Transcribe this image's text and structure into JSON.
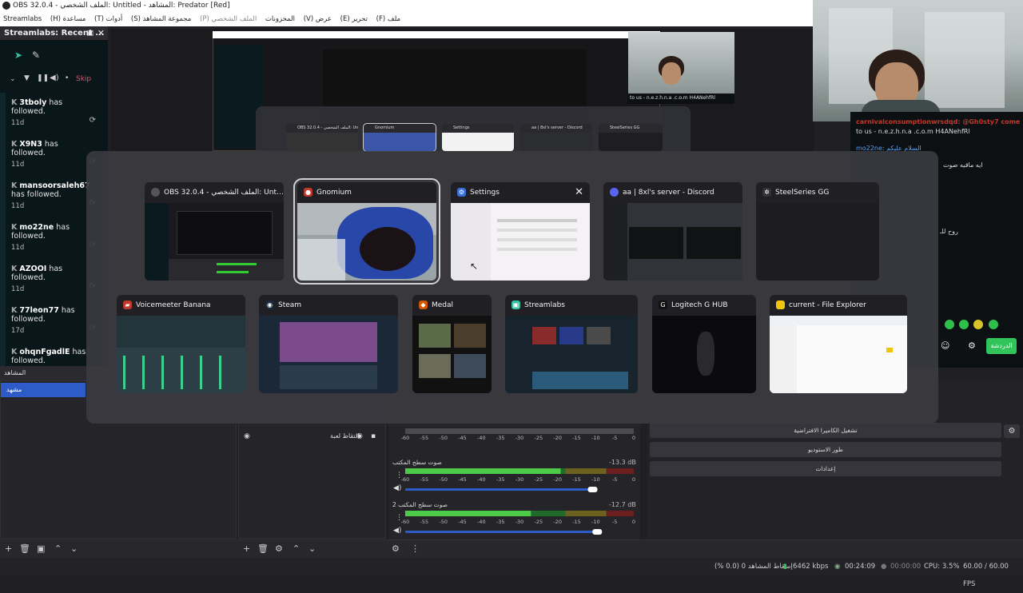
{
  "titlebar": {
    "title": "OBS 32.0.4 - الملف الشخصي: Untitled - المشاهد: Predator [Red]"
  },
  "menu": {
    "items": [
      "ملف (F)",
      "تحرير (E)",
      "عرض (V)",
      "المخزونات",
      "الملف الشخصي (P)",
      "مجموعة المشاهد (S)",
      "أدوات (T)",
      "مساعدة (H)",
      "Streamlabs"
    ]
  },
  "streamlabs": {
    "title": "Streamlabs: Recent ...",
    "skip_label": "Skip",
    "events": [
      {
        "user": "3tboly",
        "text": "has followed.",
        "age": "11d"
      },
      {
        "user": "X9N3",
        "text": "has followed.",
        "age": "11d"
      },
      {
        "user": "mansoorsaleh67",
        "text": "has followed.",
        "age": "11d"
      },
      {
        "user": "mo22ne",
        "text": "has followed.",
        "age": "11d"
      },
      {
        "user": "AZOOI",
        "text": "has followed.",
        "age": "11d"
      },
      {
        "user": "77leon77",
        "text": "has followed.",
        "age": "17d"
      },
      {
        "user": "ohqnFgadlE",
        "text": "has followed.",
        "age": ""
      }
    ]
  },
  "scenes": {
    "header": "المشاهد",
    "items": [
      "مشهد"
    ]
  },
  "sources": {
    "items": [
      "التقاط لعبة"
    ]
  },
  "mixer": {
    "scale": [
      "-60",
      "-55",
      "-50",
      "-45",
      "-40",
      "-35",
      "-30",
      "-25",
      "-20",
      "-15",
      "-10",
      "-5",
      "0"
    ],
    "channels": [
      {
        "name": "صوت سطح المكتب",
        "db": "-13.3 dB",
        "level": 0.68,
        "fader": 0.82
      },
      {
        "name": "صوت سطح المكتب 2",
        "db": "-12.7 dB",
        "level": 0.55,
        "fader": 0.84
      }
    ]
  },
  "controls": {
    "buttons": [
      "تشغيل الكاميرا الافتراضية",
      "طور الاستوديو",
      "إعدادات"
    ]
  },
  "chat": {
    "lines": [
      "carnivalconsumptionwrsdqd: @Gh0sty7 come",
      "to us - n.e.z.h.n.a .c.o.m H4ANehfRl",
      "mo22ne: السلام عليكم",
      "ايه ماقيه صوت",
      "روح للـ"
    ],
    "send_label": "الدردشة"
  },
  "preview_nested": {
    "chat_text": "to us - n.e.z.h.n.a .c.o.m H4ANehfRl",
    "mini_titles": [
      "OBS 32.0.4 - الملف الشخصي: Untitled",
      "Gnomium",
      "Settings",
      "aa | 8xl's server - Discord",
      "SteelSeries GG"
    ]
  },
  "switcher": {
    "row1": [
      {
        "title": "OBS 32.0.4 - الملف الشخصي: Untitled -...",
        "icon": "obs-icon",
        "color": "#444"
      },
      {
        "title": "Gnomium",
        "icon": "gnomium-icon",
        "color": "#c0392b",
        "selected": true
      },
      {
        "title": "Settings",
        "icon": "gear-icon",
        "color": "#3b6fd6",
        "close": true
      },
      {
        "title": "aa | 8xl's server - Discord",
        "icon": "discord-icon",
        "color": "#5865f2"
      },
      {
        "title": "SteelSeries GG",
        "icon": "steelseries-icon",
        "color": "#333"
      }
    ],
    "row2": [
      {
        "title": "Voicemeeter Banana",
        "icon": "voicemeeter-icon",
        "color": "#c0392b"
      },
      {
        "title": "Steam",
        "icon": "steam-icon",
        "color": "#1b2838"
      },
      {
        "title": "Medal",
        "icon": "medal-icon",
        "color": "#d35400"
      },
      {
        "title": "Streamlabs",
        "icon": "streamlabs-icon",
        "color": "#31c3a2"
      },
      {
        "title": "Logitech G HUB",
        "icon": "logitech-icon",
        "color": "#111"
      },
      {
        "title": "current - File Explorer",
        "icon": "folder-icon",
        "color": "#f1c40f"
      }
    ],
    "close_glyph": "✕"
  },
  "status": {
    "dropped": "إسقاط المشاهد 0 (0.0 %)",
    "bitrate": "6462 kbps",
    "live_time": "00:24:09",
    "rec_time": "00:00:00",
    "cpu": "CPU: 3.5%",
    "fps": "60.00 / 60.00 FPS"
  }
}
